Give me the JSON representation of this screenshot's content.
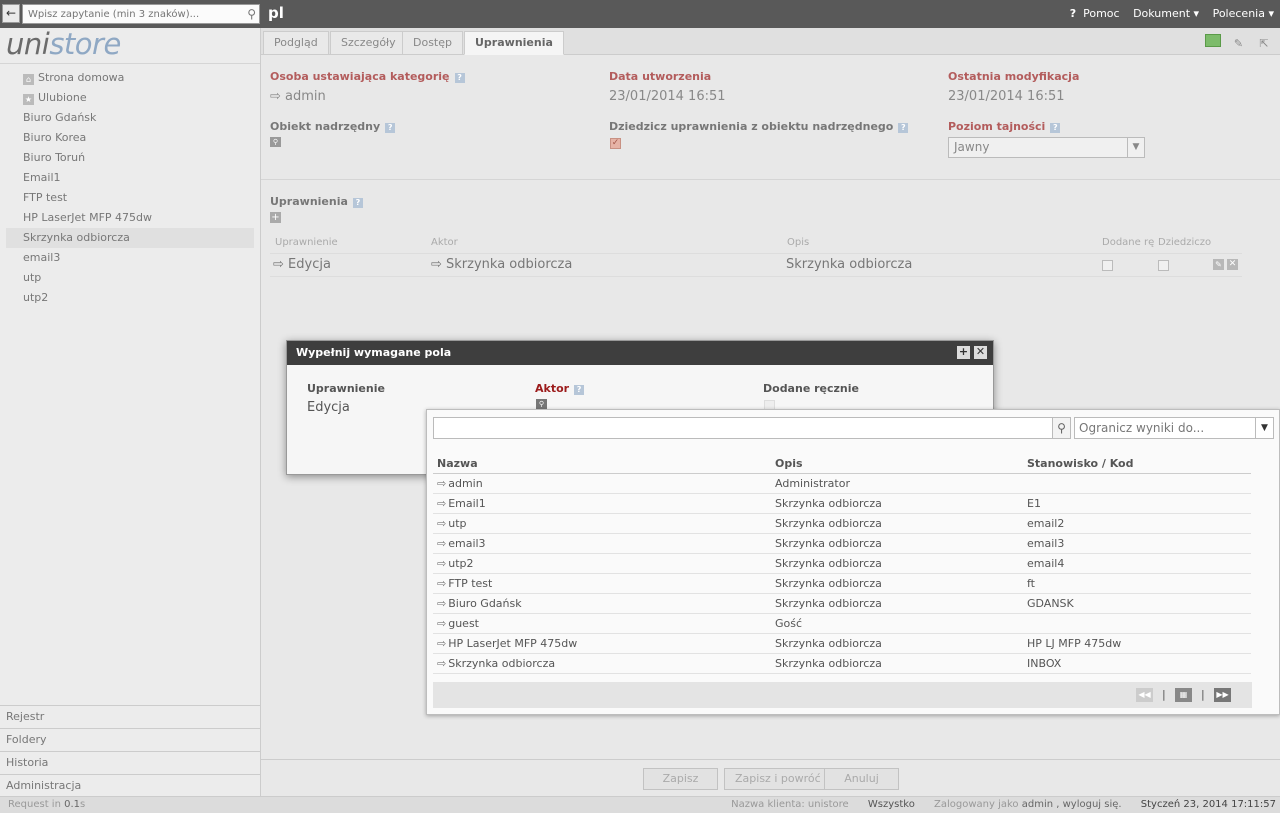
{
  "topbar": {
    "search_placeholder": "Wpisz zapytanie (min 3 znaków)...",
    "lang": "pl",
    "help": "Pomoc",
    "document_menu": "Dokument",
    "commands_menu": "Polecenia"
  },
  "sidebar": {
    "logo_a": "uni",
    "logo_b": "store",
    "items": [
      {
        "label": "Strona domowa"
      },
      {
        "label": "Ulubione"
      },
      {
        "label": "Biuro Gdańsk"
      },
      {
        "label": "Biuro Korea"
      },
      {
        "label": "Biuro Toruń"
      },
      {
        "label": "Email1"
      },
      {
        "label": "FTP test"
      },
      {
        "label": "HP LaserJet MFP 475dw"
      },
      {
        "label": "Skrzynka odbiorcza"
      },
      {
        "label": "email3"
      },
      {
        "label": "utp"
      },
      {
        "label": "utp2"
      }
    ],
    "bottom": [
      "Rejestr",
      "Foldery",
      "Historia",
      "Administracja"
    ]
  },
  "tabs": [
    "Podgląd",
    "Szczegóły",
    "Dostęp",
    "Uprawnienia"
  ],
  "form": {
    "owner_label": "Osoba ustawiająca kategorię",
    "owner_value": "admin",
    "created_label": "Data utworzenia",
    "created_value": "23/01/2014 16:51",
    "modified_label": "Ostatnia modyfikacja",
    "modified_value": "23/01/2014 16:51",
    "parent_label": "Obiekt nadrzędny",
    "inherit_label": "Dziedzicz uprawnienia z obiektu nadrzędnego",
    "secrecy_label": "Poziom tajności",
    "secrecy_value": "Jawny"
  },
  "permissions": {
    "section_label": "Uprawnienia",
    "headers": [
      "Uprawnienie",
      "Aktor",
      "Opis",
      "Dodane rę",
      "Dziedziczo"
    ],
    "row": {
      "permission": "Edycja",
      "actor": "Skrzynka odbiorcza",
      "description": "Skrzynka odbiorcza"
    }
  },
  "footer": {
    "save": "Zapisz",
    "save_return": "Zapisz i powróć",
    "cancel": "Anuluj"
  },
  "status": {
    "request_prefix": "Request in",
    "request_time": "0.1",
    "request_unit": "s",
    "client": "Nazwa klienta: unistore",
    "scope": "Wszystko",
    "logged_prefix": "Zalogowany jako",
    "logged_user": "admin",
    "logout": ", wyloguj się.",
    "datetime": "Styczeń 23, 2014 17:11:57"
  },
  "dialog": {
    "title": "Wypełnij wymagane pola",
    "perm_label": "Uprawnienie",
    "perm_value": "Edycja",
    "actor_label": "Aktor",
    "manual_label": "Dodane ręcznie"
  },
  "lookup": {
    "query": "",
    "limit_placeholder": "Ogranicz wyniki do...",
    "headers": [
      "Nazwa",
      "Opis",
      "Stanowisko / Kod"
    ],
    "rows": [
      [
        "admin",
        "Administrator",
        ""
      ],
      [
        "Email1",
        "Skrzynka odbiorcza",
        "E1"
      ],
      [
        "utp",
        "Skrzynka odbiorcza",
        "email2"
      ],
      [
        "email3",
        "Skrzynka odbiorcza",
        "email3"
      ],
      [
        "utp2",
        "Skrzynka odbiorcza",
        "email4"
      ],
      [
        "FTP test",
        "Skrzynka odbiorcza",
        "ft"
      ],
      [
        "Biuro Gdańsk",
        "Skrzynka odbiorcza",
        "GDANSK"
      ],
      [
        "guest",
        "Gość",
        ""
      ],
      [
        "HP LaserJet MFP 475dw",
        "Skrzynka odbiorcza",
        "HP LJ MFP 475dw"
      ],
      [
        "Skrzynka odbiorcza",
        "Skrzynka odbiorcza",
        "INBOX"
      ]
    ]
  }
}
